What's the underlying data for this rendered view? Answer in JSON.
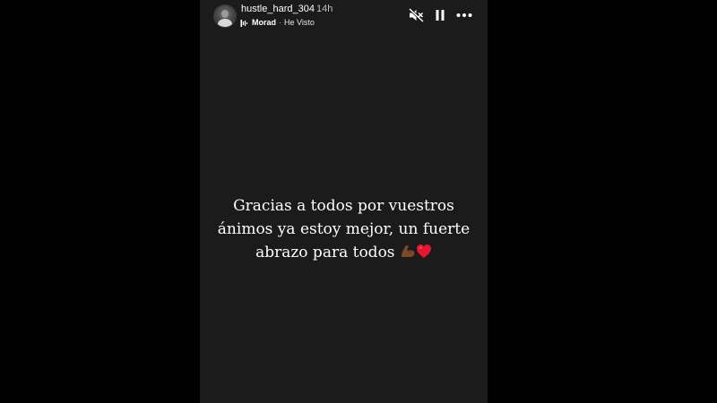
{
  "story": {
    "username": "hustle_hard_304",
    "time_ago": "14h",
    "music": {
      "icon": "music-note-icon",
      "artist": "Morad",
      "separator": "·",
      "song": "He Visto"
    },
    "controls": {
      "mute_icon": "speaker-muted-icon",
      "pause_icon": "pause-icon",
      "more_icon": "more-options-icon"
    },
    "caption": {
      "line1": "Gracias a todos por vuestros",
      "line2": "ánimos ya estoy mejor, un fuerte",
      "line3": "abrazo para todos",
      "emojis": [
        "flexed-biceps-emoji",
        "red-heart-emoji"
      ]
    },
    "colors": {
      "background": "#1b1b1b",
      "outer": "#000000",
      "text": "#ffffff",
      "heart": "#e8172f",
      "arm": "#7a4a26"
    }
  }
}
